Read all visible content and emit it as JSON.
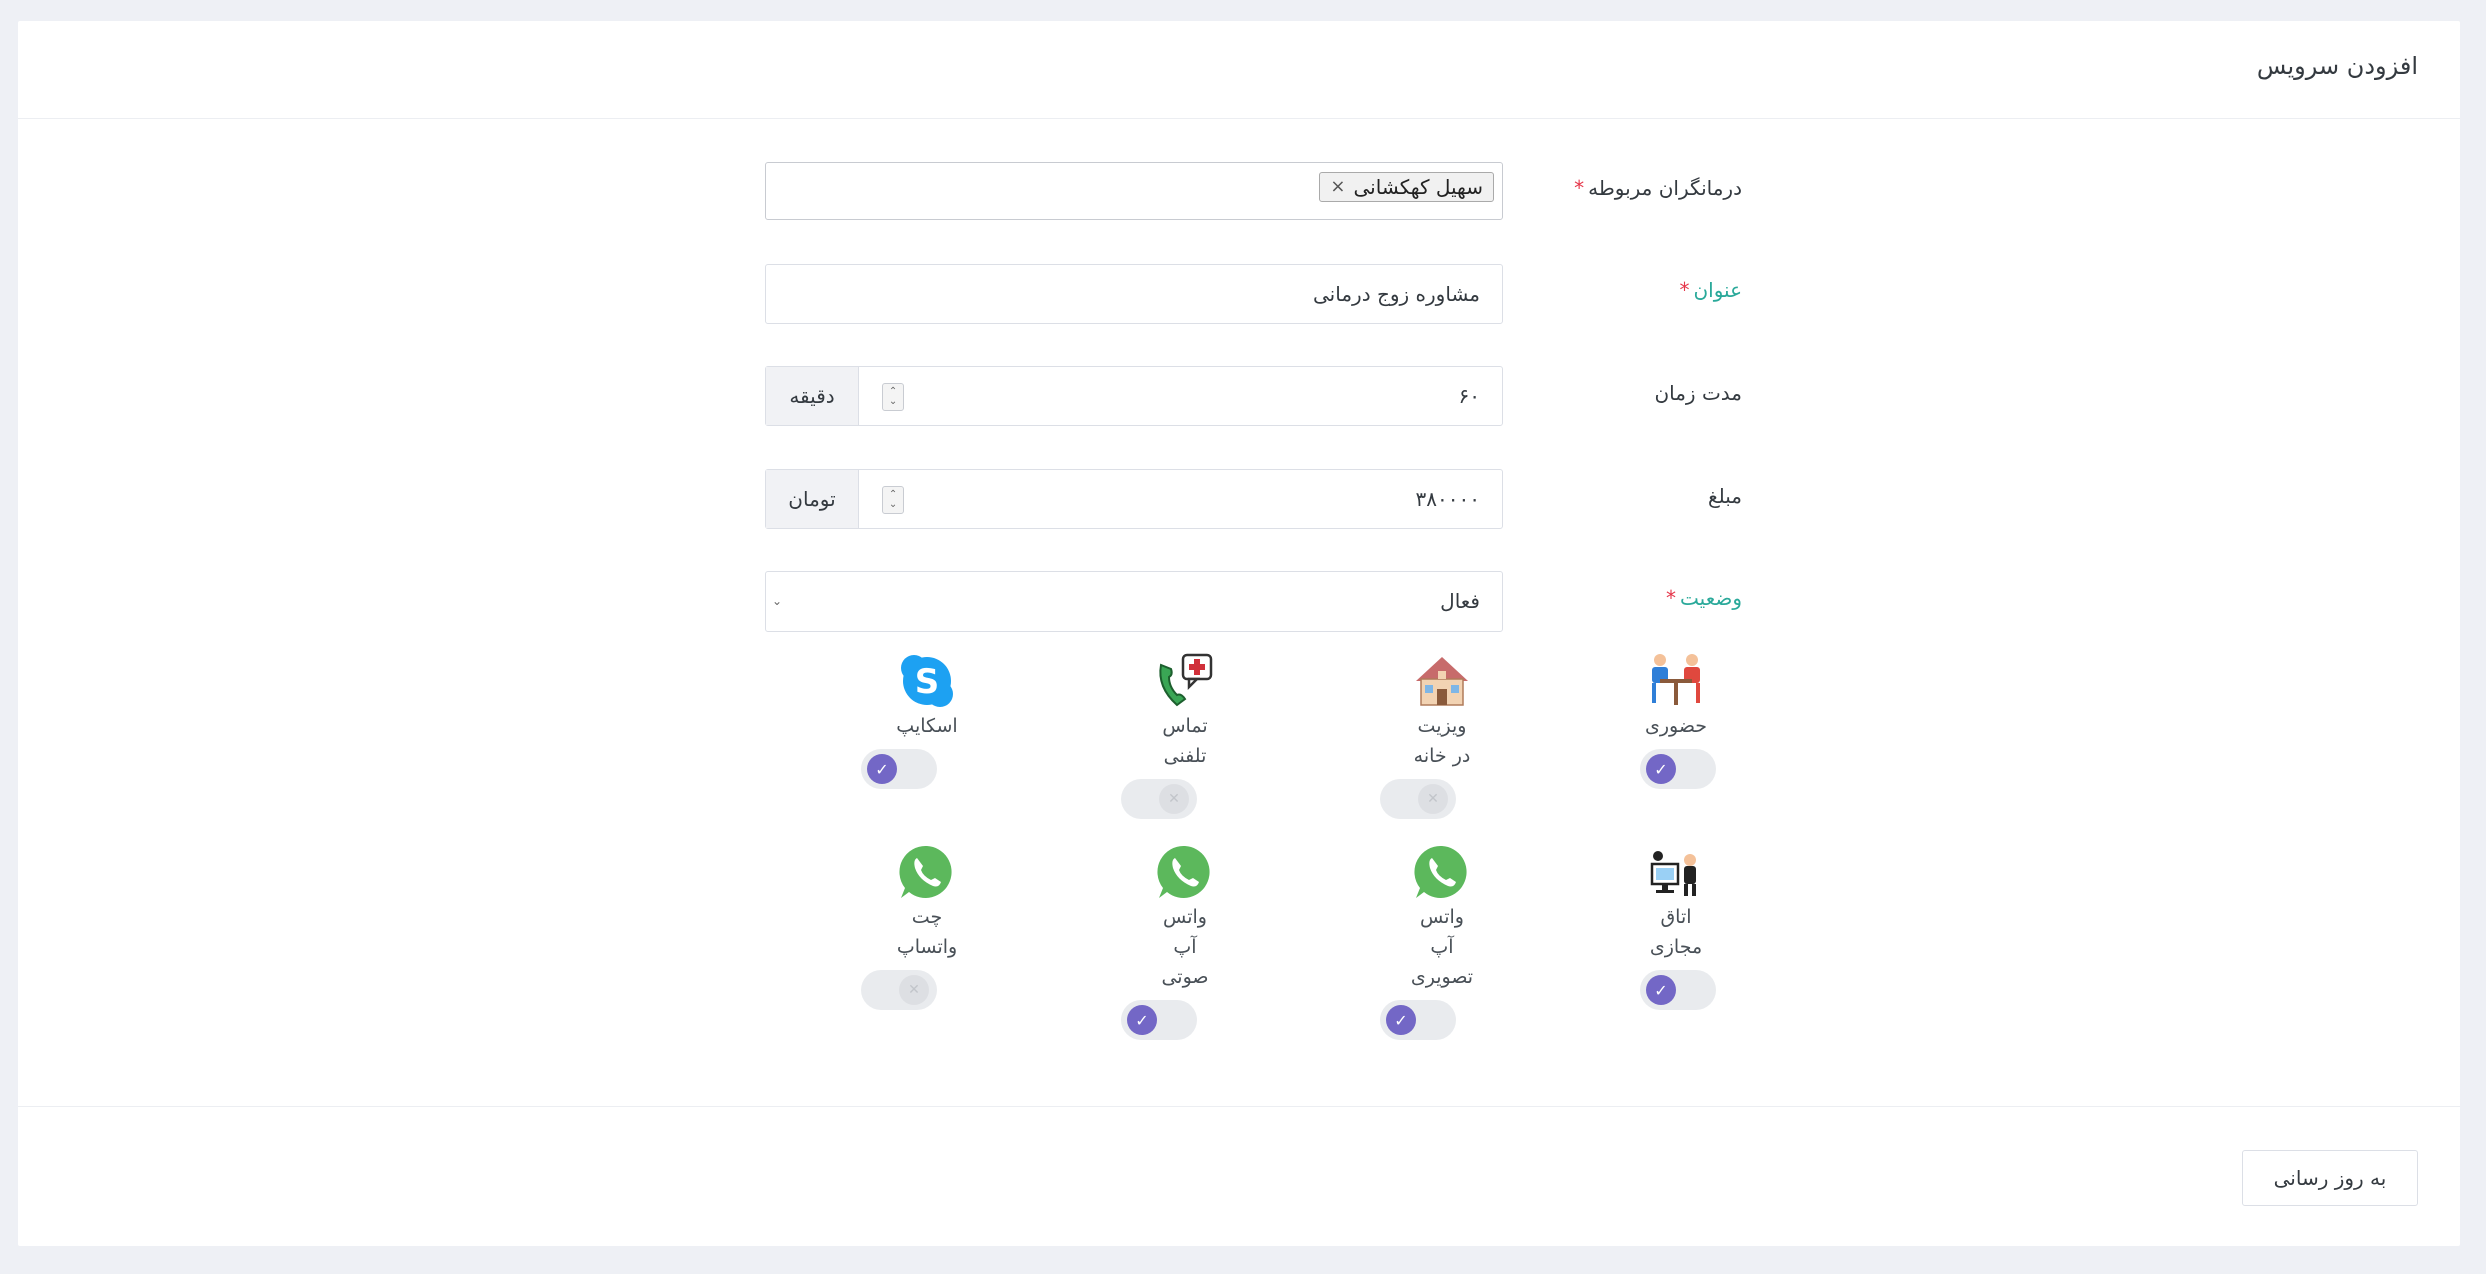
{
  "header": {
    "title": "افزودن سرویس"
  },
  "form": {
    "therapists": {
      "label": "درمانگران مربوطه",
      "required_mark": "*",
      "selected_tag": "سهیل کهکشانی",
      "remove_symbol": "×"
    },
    "title": {
      "label": "عنوان",
      "required_mark": "*",
      "value": "مشاوره زوج درمانی"
    },
    "duration": {
      "label": "مدت زمان",
      "value": "۶۰",
      "unit": "دقیقه"
    },
    "price": {
      "label": "مبلغ",
      "value": "۳۸۰۰۰۰",
      "unit": "تومان"
    },
    "status": {
      "label": "وضعیت",
      "required_mark": "*",
      "value": "فعال"
    }
  },
  "services": [
    {
      "name": "حضوری",
      "icon": "in-person-meeting-icon",
      "enabled": true
    },
    {
      "name": "ویزیت\nدر خانه",
      "icon": "house-icon",
      "enabled": false
    },
    {
      "name": "تماس\nتلفنی",
      "icon": "phone-call-medical-icon",
      "enabled": false
    },
    {
      "name": "اسکایپ",
      "icon": "skype-icon",
      "enabled": true
    },
    {
      "name": "اتاق\nمجازی",
      "icon": "virtual-room-icon",
      "enabled": true
    },
    {
      "name": "واتس\nآپ\nتصویری",
      "icon": "whatsapp-icon",
      "enabled": true
    },
    {
      "name": "واتس\nآپ\nصوتی",
      "icon": "whatsapp-icon",
      "enabled": true
    },
    {
      "name": "چت\nواتساپ",
      "icon": "whatsapp-icon",
      "enabled": false
    }
  ],
  "footer": {
    "update_label": "به روز رسانی"
  },
  "colors": {
    "accent": "#7367c6",
    "teal_label": "#2aa99a",
    "required": "#e5364a",
    "whatsapp": "#5cb85c",
    "skype": "#1da1f2"
  }
}
